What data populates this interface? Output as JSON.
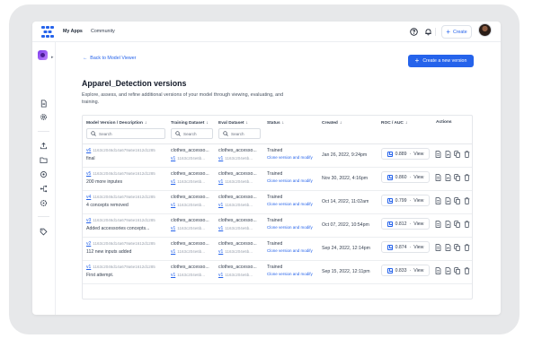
{
  "topbar": {
    "nav": [
      "My Apps",
      "Community"
    ],
    "create_label": "Create",
    "icons": [
      "help-icon",
      "bell-icon",
      "plus-icon"
    ]
  },
  "sidebar": {
    "icons": [
      "app-badge",
      "chevron-icon",
      "document-icon",
      "gear-icon",
      "upload-icon",
      "folder-icon",
      "settings-icon",
      "workflow-icon",
      "module-icon",
      "tag-icon"
    ]
  },
  "main": {
    "back_label": "Back to Model Viewer",
    "new_version_label": "Create a new version",
    "title": "Apparel_Detection versions",
    "description": "Explore, assess, and refine additional versions of your model through viewing, evaluating, and training."
  },
  "table": {
    "headers": {
      "version": "Model Version / Description",
      "training": "Training Dataset",
      "eval": "Eval Dataset",
      "status": "Status",
      "created": "Created",
      "roc": "ROC / AUC",
      "actions": "Actions"
    },
    "search_placeholder": "Search",
    "rows": [
      {
        "version": "v6",
        "hash": "1163c2046d14a679a6e1612d1285",
        "desc": "final",
        "train_name": "clothes_accesso...",
        "train_ver": "v1",
        "train_hash": "1163c204e6b...",
        "eval_name": "clothes_accesso...",
        "eval_ver": "v1",
        "eval_hash": "1163c204e6b...",
        "status": "Trained",
        "clone": "Clone version and modify",
        "created": "Jan 26, 2022, 9:24pm",
        "roc": "0.889",
        "view": "View"
      },
      {
        "version": "v5",
        "hash": "1163c2046d14a679a6e1612d1285",
        "desc": "200 more inputes",
        "train_name": "clothes_accesso...",
        "train_ver": "v1",
        "train_hash": "1163c204e6b...",
        "eval_name": "clothes_accesso...",
        "eval_ver": "v1",
        "eval_hash": "1163c204e6b...",
        "status": "Trained",
        "clone": "Clone version and modify",
        "created": "Nov 30, 2022, 4:16pm",
        "roc": "0.860",
        "view": "View"
      },
      {
        "version": "v4",
        "hash": "1163c2046d14a679a6e1612d1285",
        "desc": "4 concepts removed",
        "train_name": "clothes_accesso...",
        "train_ver": "v1",
        "train_hash": "1163c204e6b...",
        "eval_name": "clothes_accesso...",
        "eval_ver": "v1",
        "eval_hash": "1163c204e6b...",
        "status": "Trained",
        "clone": "Clone version and modify",
        "created": "Oct 14, 2022, 11:02am",
        "roc": "0.799",
        "view": "View"
      },
      {
        "version": "v3",
        "hash": "1163c2046d14a679a6e1612d1285",
        "desc": "Added accessories concepts...",
        "train_name": "clothes_accesso...",
        "train_ver": "v1",
        "train_hash": "1163c204e6b...",
        "eval_name": "clothes_accesso...",
        "eval_ver": "v1",
        "eval_hash": "1163c204e6b...",
        "status": "Trained",
        "clone": "Clone version and modify",
        "created": "Oct 07, 2022, 10:54pm",
        "roc": "0.812",
        "view": "View"
      },
      {
        "version": "v2",
        "hash": "1163c2046d14a679a6e1612d1285",
        "desc": "112 new inputs added",
        "train_name": "clothes_accesso...",
        "train_ver": "v1",
        "train_hash": "1163c204e6b...",
        "eval_name": "clothes_accesso...",
        "eval_ver": "v1",
        "eval_hash": "1163c204e6b...",
        "status": "Trained",
        "clone": "Clone version and modify",
        "created": "Sep 24, 2022, 12:14pm",
        "roc": "0.874",
        "view": "View"
      },
      {
        "version": "v1",
        "hash": "1163c2046d14a679a6e1612d1285",
        "desc": "First attempt.",
        "train_name": "clothes_accesso...",
        "train_ver": "v1",
        "train_hash": "1163c204e6b...",
        "eval_name": "clothes_accesso...",
        "eval_ver": "v1",
        "eval_hash": "1163c204e6b...",
        "status": "Trained",
        "clone": "Clone version and modify",
        "created": "Sep 15, 2022, 12:11pm",
        "roc": "0.833",
        "view": "View"
      }
    ],
    "row_actions": [
      "document-icon",
      "file-icon",
      "copy-icon",
      "trash-icon"
    ]
  },
  "colors": {
    "accent": "#2563eb",
    "frame": "#e7e8ea",
    "text": "#111827",
    "muted": "#9ca3af"
  }
}
